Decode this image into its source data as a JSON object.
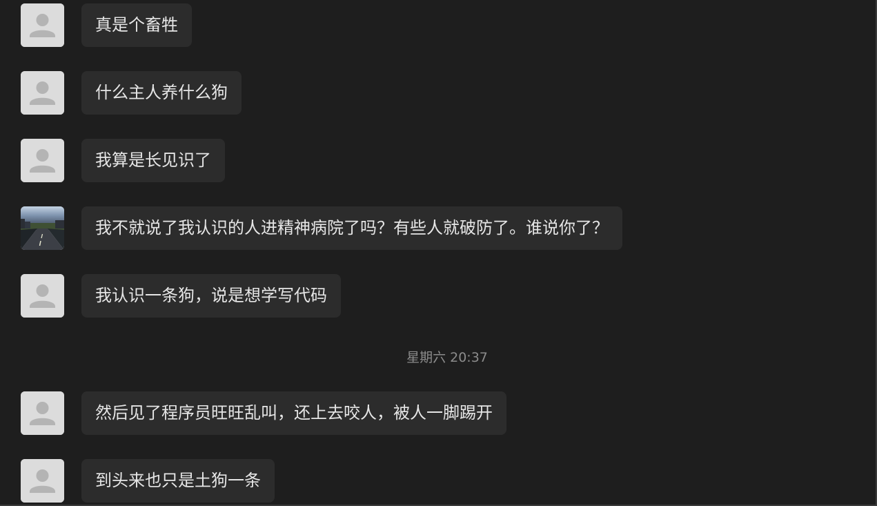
{
  "messages": [
    {
      "avatar": "default-avatar-icon",
      "text": "真是个畜牲"
    },
    {
      "avatar": "default-avatar-icon",
      "text": "什么主人养什么狗"
    },
    {
      "avatar": "default-avatar-icon",
      "text": "我算是长见识了"
    },
    {
      "avatar": "road-photo-avatar",
      "text": "我不就说了我认识的人进精神病院了吗？有些人就破防了。谁说你了？"
    },
    {
      "avatar": "default-avatar-icon",
      "text": "我认识一条狗，说是想学写代码"
    },
    {
      "avatar": "default-avatar-icon",
      "text": "然后见了程序员旺旺乱叫，还上去咬人，被人一脚踢开"
    },
    {
      "avatar": "default-avatar-icon",
      "text": "到头来也只是土狗一条"
    }
  ],
  "timestamp": "星期六 20:37",
  "colors": {
    "background": "#1e1e1e",
    "bubble": "#2c2c2c",
    "text": "#e6e6e6",
    "timestamp": "#8c8c8c",
    "default_avatar_bg": "#dcdcdc",
    "default_avatar_figure": "#b4b4b4"
  }
}
